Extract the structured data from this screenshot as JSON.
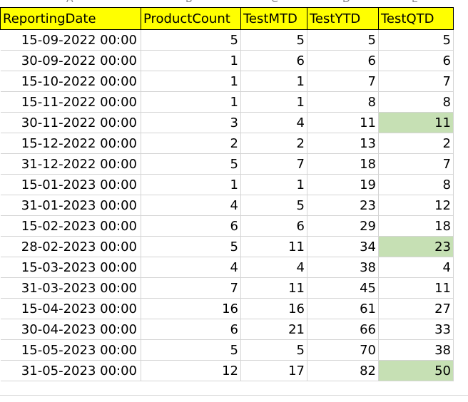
{
  "column_letters": [
    "A",
    "B",
    "C",
    "D",
    "E"
  ],
  "headers": [
    "ReportingDate",
    "ProductCount",
    "TestMTD",
    "TestYTD",
    "TestQTD"
  ],
  "header_fill": "#ffff00",
  "highlight_fill": "#c6e0b4",
  "rows": [
    {
      "date": "15-09-2022 00:00",
      "product_count": "5",
      "mtd": "5",
      "ytd": "5",
      "qtd": "5",
      "qtd_highlight": false
    },
    {
      "date": "30-09-2022 00:00",
      "product_count": "1",
      "mtd": "6",
      "ytd": "6",
      "qtd": "6",
      "qtd_highlight": false
    },
    {
      "date": "15-10-2022 00:00",
      "product_count": "1",
      "mtd": "1",
      "ytd": "7",
      "qtd": "7",
      "qtd_highlight": false
    },
    {
      "date": "15-11-2022 00:00",
      "product_count": "1",
      "mtd": "1",
      "ytd": "8",
      "qtd": "8",
      "qtd_highlight": false
    },
    {
      "date": "30-11-2022 00:00",
      "product_count": "3",
      "mtd": "4",
      "ytd": "11",
      "qtd": "11",
      "qtd_highlight": true
    },
    {
      "date": "15-12-2022 00:00",
      "product_count": "2",
      "mtd": "2",
      "ytd": "13",
      "qtd": "2",
      "qtd_highlight": false
    },
    {
      "date": "31-12-2022 00:00",
      "product_count": "5",
      "mtd": "7",
      "ytd": "18",
      "qtd": "7",
      "qtd_highlight": false
    },
    {
      "date": "15-01-2023 00:00",
      "product_count": "1",
      "mtd": "1",
      "ytd": "19",
      "qtd": "8",
      "qtd_highlight": false
    },
    {
      "date": "31-01-2023 00:00",
      "product_count": "4",
      "mtd": "5",
      "ytd": "23",
      "qtd": "12",
      "qtd_highlight": false
    },
    {
      "date": "15-02-2023 00:00",
      "product_count": "6",
      "mtd": "6",
      "ytd": "29",
      "qtd": "18",
      "qtd_highlight": false
    },
    {
      "date": "28-02-2023 00:00",
      "product_count": "5",
      "mtd": "11",
      "ytd": "34",
      "qtd": "23",
      "qtd_highlight": true
    },
    {
      "date": "15-03-2023 00:00",
      "product_count": "4",
      "mtd": "4",
      "ytd": "38",
      "qtd": "4",
      "qtd_highlight": false
    },
    {
      "date": "31-03-2023 00:00",
      "product_count": "7",
      "mtd": "11",
      "ytd": "45",
      "qtd": "11",
      "qtd_highlight": false
    },
    {
      "date": "15-04-2023 00:00",
      "product_count": "16",
      "mtd": "16",
      "ytd": "61",
      "qtd": "27",
      "qtd_highlight": false
    },
    {
      "date": "30-04-2023 00:00",
      "product_count": "6",
      "mtd": "21",
      "ytd": "66",
      "qtd": "33",
      "qtd_highlight": false
    },
    {
      "date": "15-05-2023 00:00",
      "product_count": "5",
      "mtd": "5",
      "ytd": "70",
      "qtd": "38",
      "qtd_highlight": false
    },
    {
      "date": "31-05-2023 00:00",
      "product_count": "12",
      "mtd": "17",
      "ytd": "82",
      "qtd": "50",
      "qtd_highlight": true
    }
  ]
}
